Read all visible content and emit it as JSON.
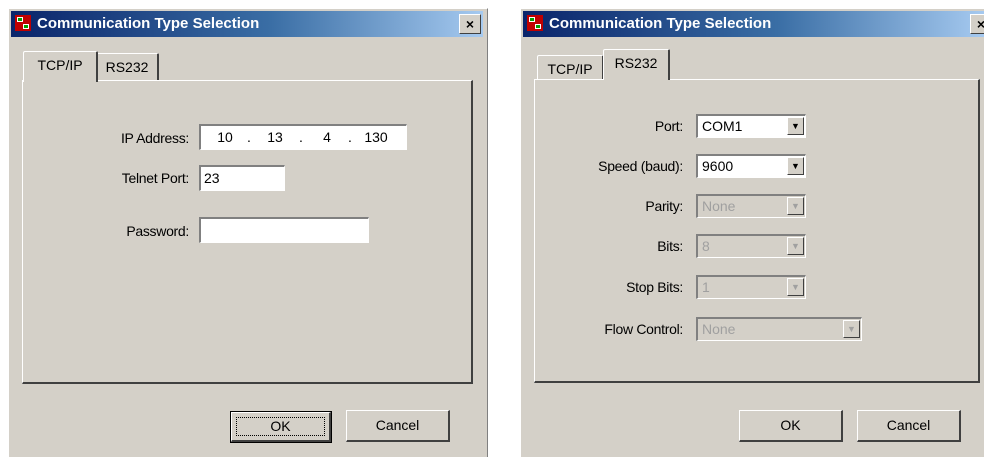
{
  "dialog_tcpip": {
    "title": "Communication Type Selection",
    "close_glyph": "×",
    "tabs": [
      {
        "label": "TCP/IP",
        "active": true
      },
      {
        "label": "RS232",
        "active": false
      }
    ],
    "ip_address": {
      "label": "IP Address:",
      "octets": [
        "10",
        "13",
        "4",
        "130"
      ],
      "separator": "."
    },
    "telnet_port": {
      "label": "Telnet Port:",
      "value": "23"
    },
    "password": {
      "label": "Password:",
      "value": ""
    },
    "ok_label": "OK",
    "cancel_label": "Cancel"
  },
  "dialog_rs232": {
    "title": "Communication Type Selection",
    "close_glyph": "×",
    "tabs": [
      {
        "label": "TCP/IP",
        "active": false
      },
      {
        "label": "RS232",
        "active": true
      }
    ],
    "port": {
      "label": "Port:",
      "value": "COM1",
      "enabled": true
    },
    "speed": {
      "label": "Speed (baud):",
      "value": "9600",
      "enabled": true
    },
    "parity": {
      "label": "Parity:",
      "value": "None",
      "enabled": false
    },
    "bits": {
      "label": "Bits:",
      "value": "8",
      "enabled": false
    },
    "stop_bits": {
      "label": "Stop Bits:",
      "value": "1",
      "enabled": false
    },
    "flow_control": {
      "label": "Flow Control:",
      "value": "None",
      "enabled": false
    },
    "ok_label": "OK",
    "cancel_label": "Cancel"
  },
  "icons": {
    "app": "app-window-icon",
    "close": "close-icon",
    "dropdown": "chevron-down-icon"
  },
  "colors": {
    "titlebar_start": "#0a246a",
    "titlebar_end": "#a6caf0",
    "face": "#d4d0c8"
  }
}
